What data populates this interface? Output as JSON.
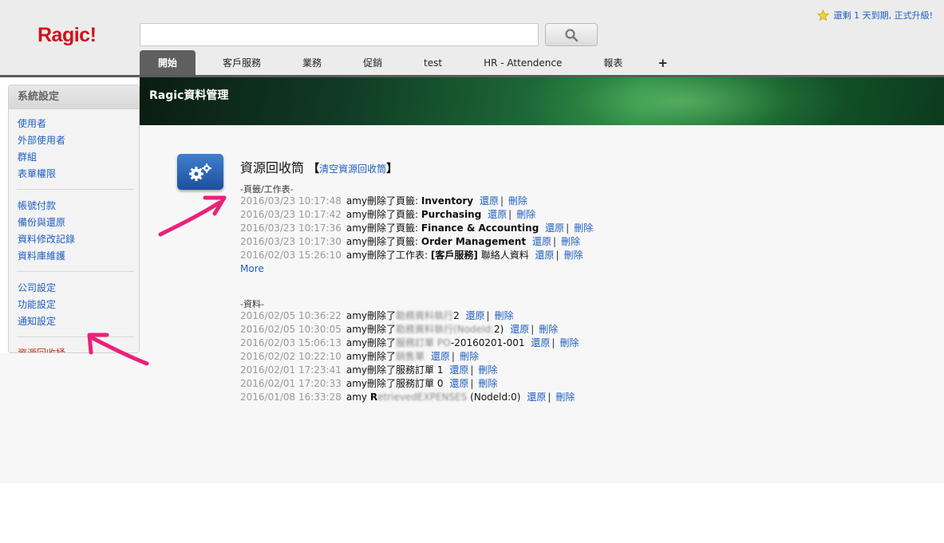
{
  "app": {
    "logo": "Ragic!"
  },
  "header": {
    "search_placeholder": "",
    "upgrade_text": "還剩 1 天到期, 正式升級!",
    "tabs": [
      {
        "label": "開始",
        "active": true
      },
      {
        "label": "客戶服務"
      },
      {
        "label": "業務"
      },
      {
        "label": "促銷"
      },
      {
        "label": "test"
      },
      {
        "label": "HR - Attendence"
      },
      {
        "label": "報表"
      },
      {
        "label": "+"
      }
    ]
  },
  "sidebar": {
    "title": "系統設定",
    "groups": [
      [
        "使用者",
        "外部使用者",
        "群組",
        "表單權限"
      ],
      [
        "帳號付款",
        "備份與還原",
        "資料修改記錄",
        "資料庫維護"
      ],
      [
        "公司設定",
        "功能設定",
        "通知設定"
      ],
      [
        "資源回收桶"
      ]
    ],
    "active_item": "資源回收桶"
  },
  "banner": {
    "title": "Ragic資料管理"
  },
  "main": {
    "title": "資源回收筒",
    "clear_link": "清空資源回收筒",
    "bracket_open": "【",
    "bracket_close": "】",
    "pages_section": {
      "label": "-頁籤/工作表-",
      "rows": [
        {
          "time": "2016/03/23 10:17:48",
          "user": "amy",
          "action": "刪除了頁籤: ",
          "target": "Inventory",
          "restore": "還原",
          "delete": "刪除"
        },
        {
          "time": "2016/03/23 10:17:42",
          "user": "amy",
          "action": "刪除了頁籤: ",
          "target": "Purchasing",
          "restore": "還原",
          "delete": "刪除"
        },
        {
          "time": "2016/03/23 10:17:36",
          "user": "amy",
          "action": "刪除了頁籤: ",
          "target": "Finance & Accounting",
          "restore": "還原",
          "delete": "刪除"
        },
        {
          "time": "2016/03/23 10:17:30",
          "user": "amy",
          "action": "刪除了頁籤: ",
          "target": "Order Management",
          "restore": "還原",
          "delete": "刪除"
        },
        {
          "time": "2016/02/03 15:26:10",
          "user": "amy",
          "action": "刪除了工作表: ",
          "target": "[客戶服務]",
          "extra": " 聯絡人資料",
          "restore": "還原",
          "delete": "刪除"
        }
      ],
      "more": "More"
    },
    "data_section": {
      "label": "-資料-",
      "rows": [
        {
          "time": "2016/02/05 10:36:22",
          "user": "amy",
          "action": "刪除了",
          "blurred": "勘務資料執行",
          "target": "2",
          "restore": "還原",
          "delete": "刪除"
        },
        {
          "time": "2016/02/05 10:30:05",
          "user": "amy",
          "action": "刪除了",
          "blurred": "勘務資料執行(Nodeld:",
          "target": "2)",
          "restore": "還原",
          "delete": "刪除"
        },
        {
          "time": "2016/02/03 15:06:13",
          "user": "amy",
          "action": "刪除了",
          "blurred": "服務訂單 PO",
          "target": "-20160201-001",
          "restore": "還原",
          "delete": "刪除"
        },
        {
          "time": "2016/02/02 10:22:10",
          "user": "amy",
          "action": "刪除了",
          "blurred": "銷售單",
          "target": "",
          "restore": "還原",
          "delete": "刪除"
        },
        {
          "time": "2016/02/01 17:23:41",
          "user": "amy",
          "action": "刪除了服務訂單 1",
          "blurred": "",
          "target": "",
          "restore": "還原",
          "delete": "刪除"
        },
        {
          "time": "2016/02/01 17:20:33",
          "user": "amy",
          "action": "刪除了服務訂單 0",
          "blurred": "",
          "target": "",
          "restore": "還原",
          "delete": "刪除"
        },
        {
          "time": "2016/01/08 16:33:28",
          "user": "amy ",
          "action": "R",
          "blurred": "etrievedEXPENSES",
          "target": " (Nodeld:0)",
          "restore": "還原",
          "delete": "刪除"
        }
      ]
    }
  },
  "colors": {
    "logo": "#d0121c",
    "link": "#1f5fbf",
    "arrow": "#e8227a",
    "active_sidebar": "#d0321c"
  },
  "icons": {
    "search": "search-icon",
    "star": "star-icon",
    "gear": "gears-icon"
  }
}
